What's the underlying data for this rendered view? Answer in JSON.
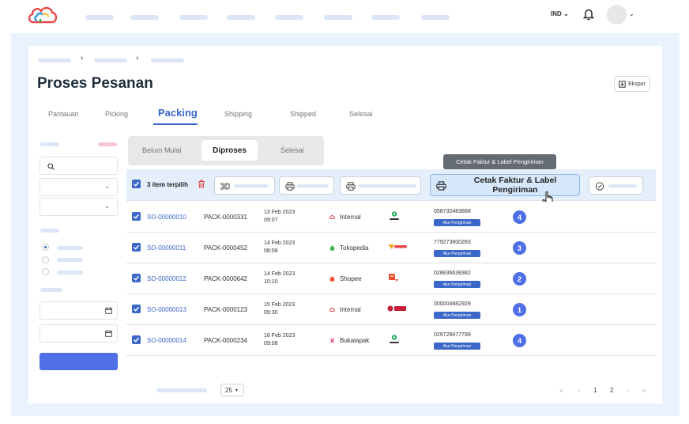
{
  "header": {
    "language": "IND",
    "icons": [
      "cloud-logo-icon",
      "bell-icon",
      "chevron-down-icon"
    ]
  },
  "page": {
    "title": "Proses Pesanan",
    "export_label": "Ekspor"
  },
  "main_tabs": [
    {
      "label": "Pantauan",
      "active": false
    },
    {
      "label": "Picking",
      "active": false
    },
    {
      "label": "Packing",
      "active": true
    },
    {
      "label": "Shipping",
      "active": false
    },
    {
      "label": "Shipped",
      "active": false
    },
    {
      "label": "Selesai",
      "active": false
    }
  ],
  "sub_tabs": [
    {
      "label": "Belum Mulai",
      "active": false
    },
    {
      "label": "Diproses",
      "active": true
    },
    {
      "label": "Selesai",
      "active": false
    }
  ],
  "toolbar": {
    "selected_label": "3 item terpilih",
    "print_button_label": "Cetak Faktur & Label Pengiriman",
    "tooltip": "Cetak Faktur & Label Pengiriman"
  },
  "rows": [
    {
      "so": "SO-00000010",
      "pack": "PACK-0000331",
      "date": "13 Feb 2023",
      "time": "09:07",
      "marketplace": "Internal",
      "courier": "gosend",
      "tracking": "058732483888",
      "action": "Atur Pengiriman",
      "count": "4"
    },
    {
      "so": "SO-00000011",
      "pack": "PACK-0000452",
      "date": "14 Feb 2023",
      "time": "08:08",
      "marketplace": "Tokopedia",
      "courier": "anteraja",
      "tracking": "779273800283",
      "action": "Atur Pengiriman",
      "count": "3"
    },
    {
      "so": "SO-00000012",
      "pack": "PACK-0000642",
      "date": "14 Feb 2023",
      "time": "10:10",
      "marketplace": "Shopee",
      "courier": "shopee-express",
      "tracking": "028836638382",
      "action": "Atur Pengiriman",
      "count": "2"
    },
    {
      "so": "SO-00000013",
      "pack": "PACK-0000123",
      "date": "15 Feb 2023",
      "time": "09:30",
      "marketplace": "Internal",
      "courier": "ninja",
      "tracking": "000004882929",
      "action": "Atur Pengiriman",
      "count": "1"
    },
    {
      "so": "SO-00000014",
      "pack": "PACK-0000234",
      "date": "16 Feb 2023",
      "time": "09:08",
      "marketplace": "Bukalapak",
      "courier": "gosend",
      "tracking": "029729477799",
      "action": "Atur Pengiriman",
      "count": "4"
    }
  ],
  "pagination": {
    "page_size": "25",
    "first": "«",
    "prev": "‹",
    "pages": [
      "1",
      "2"
    ],
    "next": "›",
    "last": "»"
  },
  "colors": {
    "accent": "#3b67c8",
    "button": "#4f6fe6",
    "background": "#eaf2fd",
    "toolbar": "#e5effb"
  }
}
